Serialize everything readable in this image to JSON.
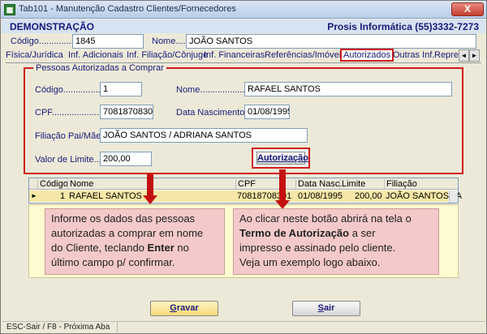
{
  "window": {
    "title": "Tab101 - Manutenção Cadastro Clientes/Fornecedores",
    "close_label": "X",
    "app_icon": "table-icon"
  },
  "header": {
    "company": "DEMONSTRAÇÃO",
    "vendor": "Prosis Informática (55)3332-7273"
  },
  "client": {
    "codigo_label": "Código...............",
    "codigo_value": "1845",
    "nome_label": "Nome.....:",
    "nome_value": "JOÃO SANTOS"
  },
  "tabs": [
    {
      "label": "Física/Jurídica",
      "active": false
    },
    {
      "label": "Inf. Adicionais",
      "active": false
    },
    {
      "label": "Inf. Filiação/Cônjuge",
      "active": false
    },
    {
      "label": "Inf. Financeiras",
      "active": false
    },
    {
      "label": "Referências/Imóveis",
      "active": false
    },
    {
      "label": "Autorizados",
      "active": true
    },
    {
      "label": "Outras Inf.",
      "active": false
    },
    {
      "label": "Repre",
      "active": false
    }
  ],
  "tab_arrows": {
    "left": "◄",
    "right": "►"
  },
  "section": {
    "legend": "Pessoas Autorizadas a Comprar",
    "codigo_label": "Código...................",
    "codigo_value": "1",
    "nome_label": "Nome........................",
    "nome_value": "RAFAEL SANTOS",
    "cpf_label": "CPF..........................",
    "cpf_value": "70818708301",
    "nasc_label": "Data Nascimento:",
    "nasc_value": "01/08/1995",
    "filiacao_label": "Filiação Pai/Mãe:",
    "filiacao_value": "JOÃO SANTOS / ADRIANA SANTOS",
    "limite_label": "Valor de Limite.....:",
    "limite_value": "200,00",
    "autorizacao_button": "Autorização"
  },
  "grid": {
    "columns": [
      "Código",
      "Nome",
      "CPF",
      "Data Nasc.",
      "Limite",
      "Filiação"
    ],
    "rows": [
      {
        "codigo": "1",
        "nome": "RAFAEL SANTOS",
        "cpf": "70818708301",
        "nasc": "01/08/1995",
        "limite": "200,00",
        "filiacao": "JOÃO SANTOS / A"
      }
    ],
    "row_marker": "►"
  },
  "callouts": {
    "left": {
      "line1": "Informe os dados das pessoas",
      "line2": "autorizadas a comprar em nome",
      "line3_pre": "do Cliente, teclando ",
      "line3_bold": "Enter",
      "line3_post": " no",
      "line4": "último campo p/ confirmar."
    },
    "right": {
      "line1": "Ao clicar neste botão abrirá na tela o",
      "line2_bold": "Termo de Autorização",
      "line2_post": " a ser",
      "line3": "impresso e assinado pelo cliente.",
      "line4": "Veja um exemplo logo abaixo."
    }
  },
  "buttons": {
    "gravar_first": "G",
    "gravar_rest": "ravar",
    "sair_first": "S",
    "sair_rest": "air"
  },
  "status": {
    "text": "ESC-Sair / F8 - Próxima Aba"
  },
  "colors": {
    "accent_red": "#d11b1b",
    "arrow_red": "#c41010",
    "callout_bg": "#f4c9c9",
    "label_blue": "#1a1a7a",
    "highlight_row": "#f7e7a6"
  }
}
